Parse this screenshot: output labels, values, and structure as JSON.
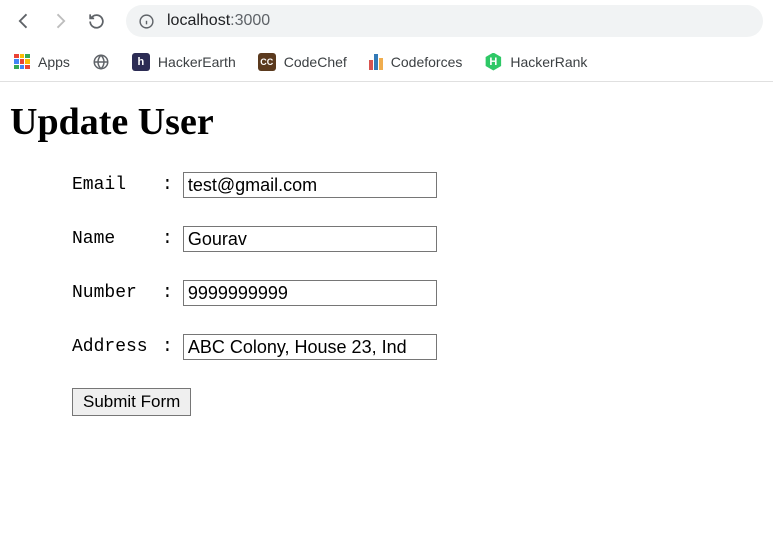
{
  "browser": {
    "url_host": "localhost",
    "url_port": ":3000"
  },
  "bookmarks": {
    "apps_label": "Apps",
    "items": [
      {
        "label": "HackerEarth"
      },
      {
        "label": "CodeChef"
      },
      {
        "label": "Codeforces"
      },
      {
        "label": "HackerRank"
      }
    ]
  },
  "page": {
    "title": "Update User",
    "form": {
      "fields": [
        {
          "label": "Email  ",
          "value": "test@gmail.com"
        },
        {
          "label": "Name   ",
          "value": "Gourav"
        },
        {
          "label": "Number ",
          "value": "9999999999"
        },
        {
          "label": "Address",
          "value": "ABC Colony, House 23, Ind"
        }
      ],
      "submit_label": "Submit Form"
    }
  }
}
